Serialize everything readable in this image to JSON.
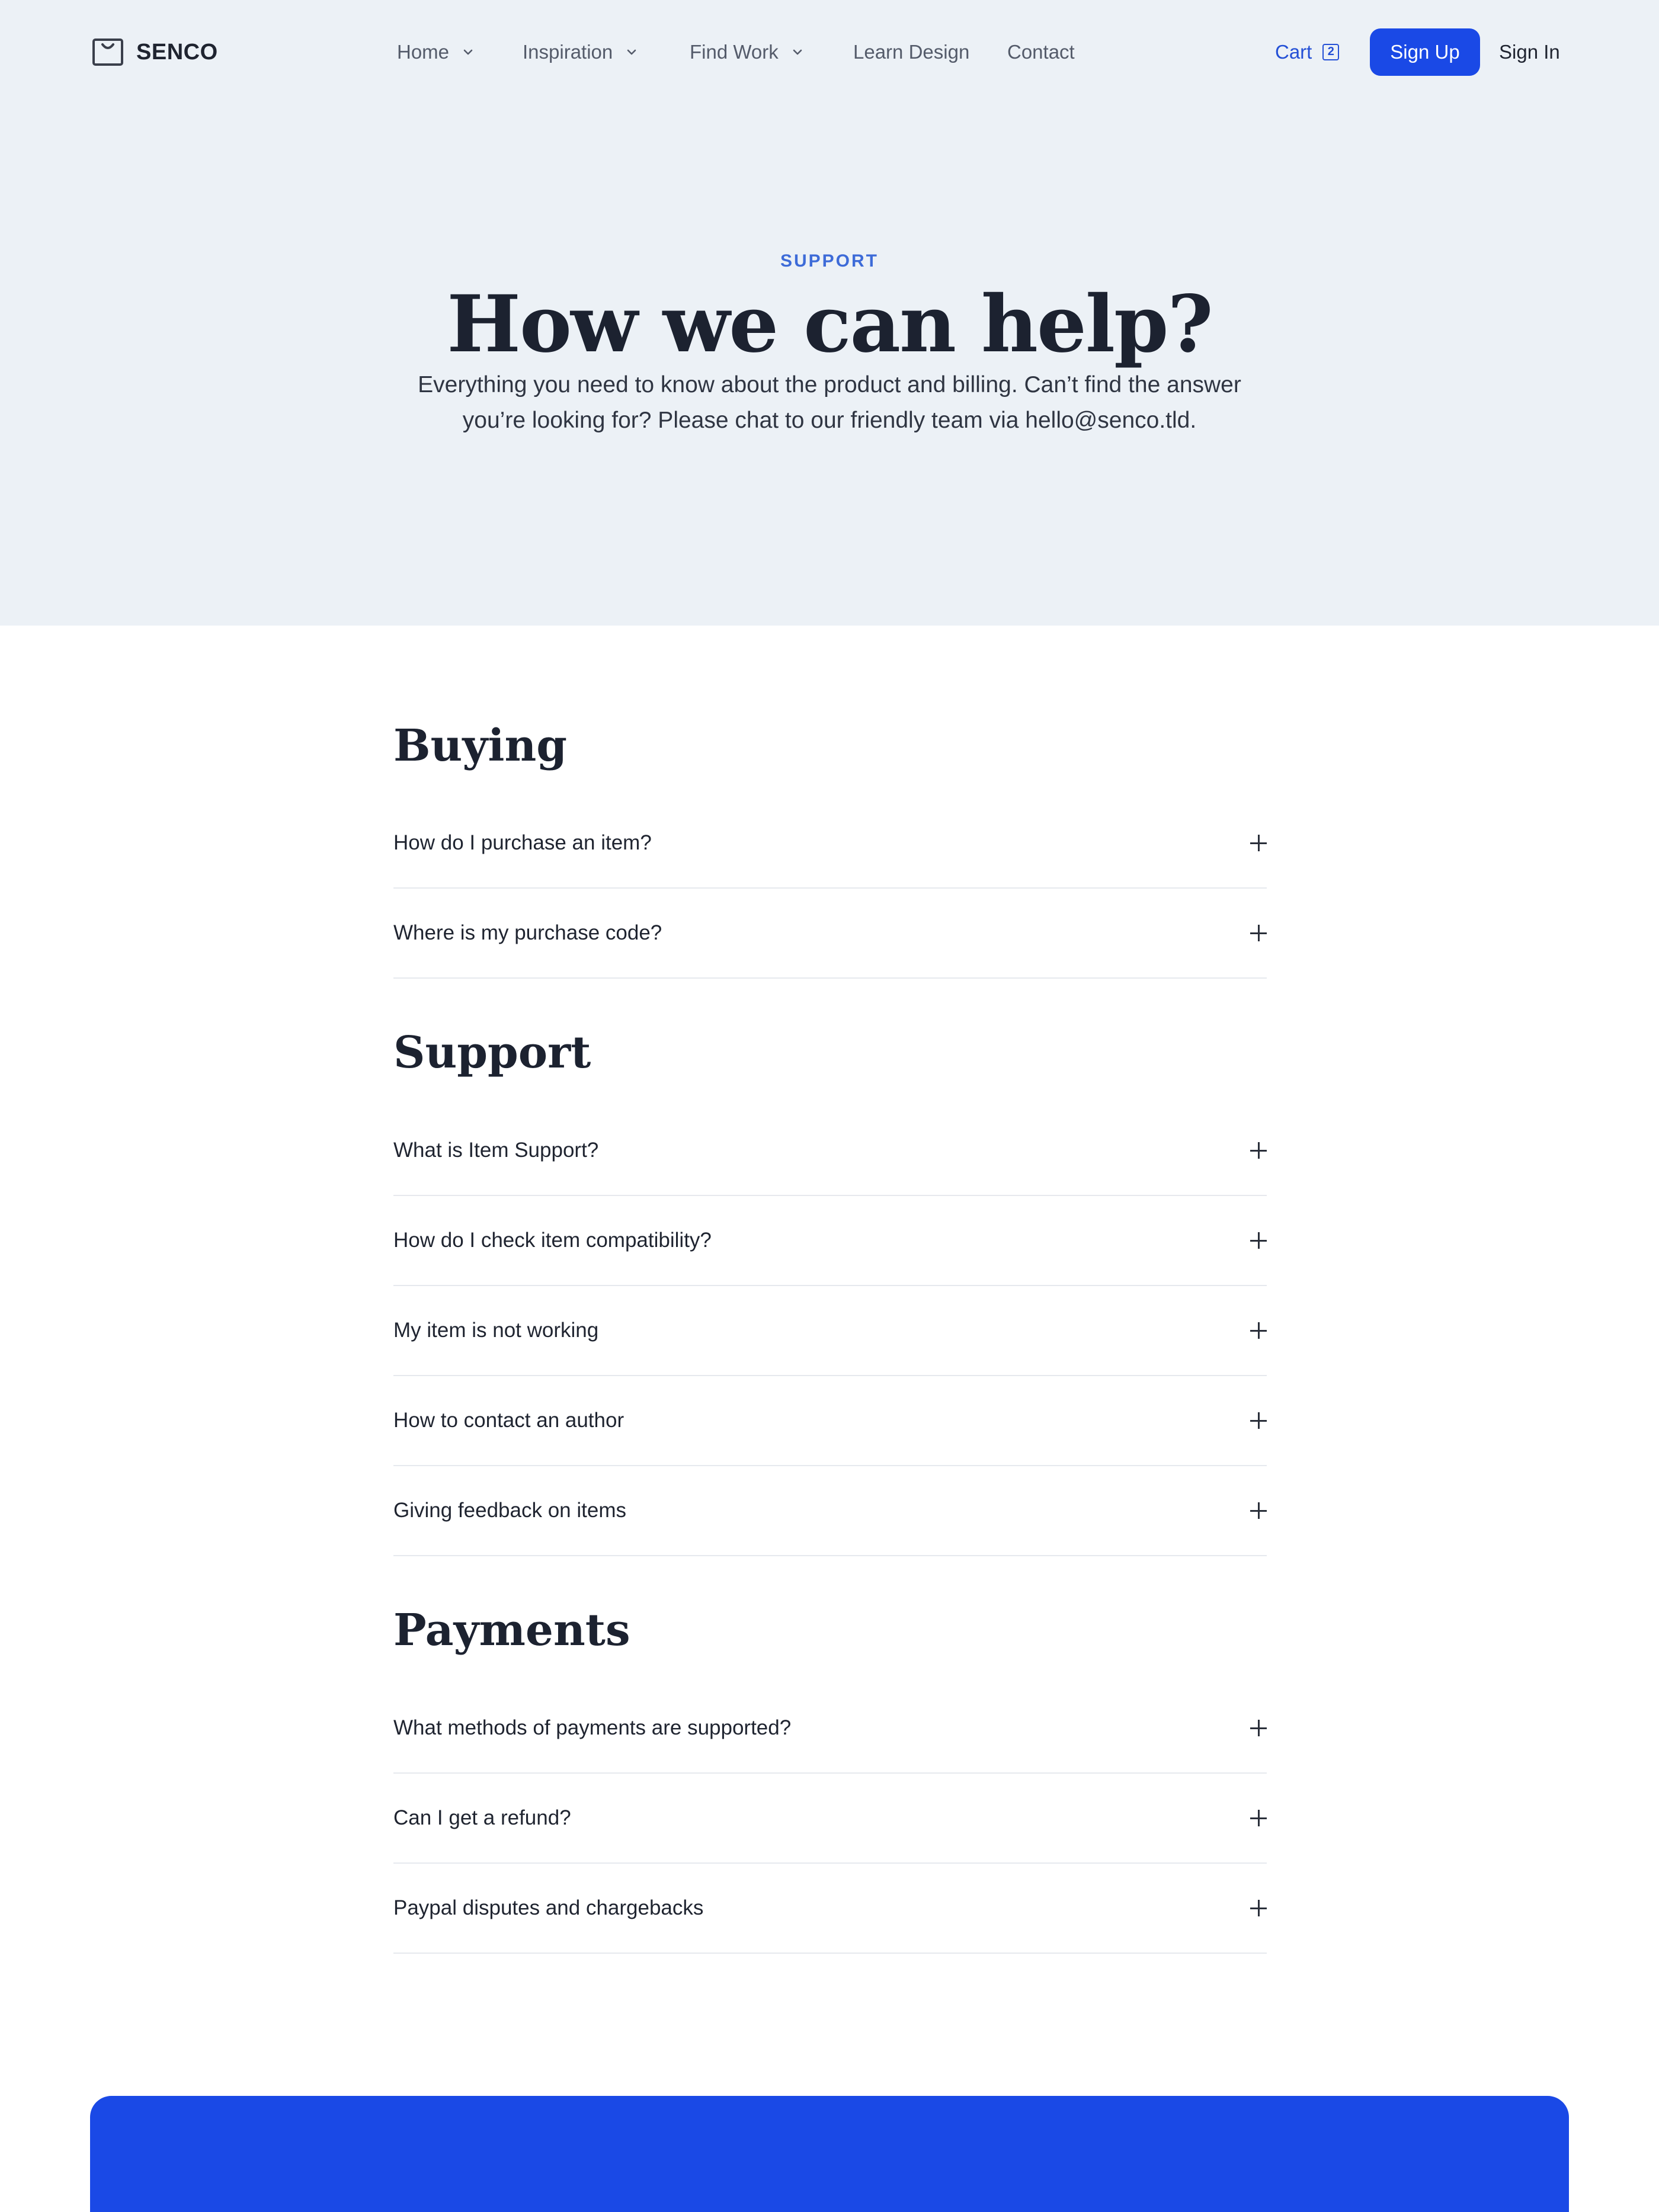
{
  "brand": {
    "name": "SENCO",
    "icon": "shopping-bag-icon"
  },
  "nav": {
    "items": [
      {
        "label": "Home",
        "has_dropdown": true
      },
      {
        "label": "Inspiration",
        "has_dropdown": true
      },
      {
        "label": "Find Work",
        "has_dropdown": true
      },
      {
        "label": "Learn Design",
        "has_dropdown": false
      },
      {
        "label": "Contact",
        "has_dropdown": false
      }
    ],
    "cart_label": "Cart",
    "cart_count": "2",
    "signup_label": "Sign Up",
    "signin_label": "Sign In"
  },
  "hero": {
    "eyebrow": "SUPPORT",
    "title": "How we can help?",
    "subtitle": "Everything you need to know about the product and billing. Can’t find the answer you’re looking for? Please chat to our friendly team via hello@senco.tld."
  },
  "faq": {
    "sections": [
      {
        "title": "Buying",
        "questions": [
          "How do I purchase an item?",
          "Where is my purchase code?"
        ]
      },
      {
        "title": "Support",
        "questions": [
          "What is Item Support?",
          "How do I check item compatibility?",
          "My item is not working",
          "How to contact an author",
          "Giving feedback on items"
        ]
      },
      {
        "title": "Payments",
        "questions": [
          "What methods of payments are supported?",
          "Can I get a refund?",
          "Paypal disputes and chargebacks"
        ]
      }
    ]
  },
  "colors": {
    "accent": "#1a49e6",
    "hero_bg": "#ecf1f6",
    "eyebrow": "#3d6bd8",
    "heading": "#1c2230"
  }
}
